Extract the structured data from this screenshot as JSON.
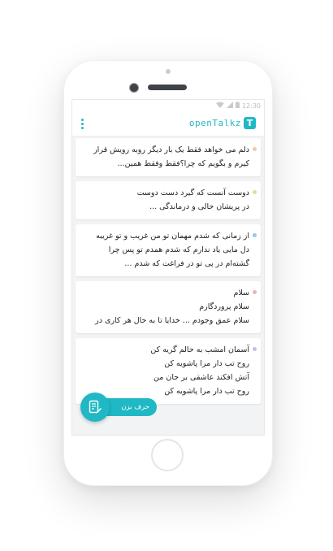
{
  "status_bar": {
    "time": "12:30",
    "icons": [
      "wifi-icon",
      "signal-icon",
      "battery-icon"
    ]
  },
  "app_bar": {
    "brand": "openTalkz",
    "logo_letter": "T",
    "menu_icon": "more-vert-icon"
  },
  "colors": {
    "accent": "#1fb8c4",
    "background": "#f1f3f4"
  },
  "posts": [
    {
      "dot_color": "#f4c7a3",
      "lines": [
        "دلم می خواهد فقط یک بار دیگر روبه رویش قرار",
        "کیرم و بگویم که چرا؟فقط وفقط همین..."
      ]
    },
    {
      "dot_color": "#c9e89a",
      "lines": [
        "دوست آنست که گیرد دست دوست",
        "در پریشان حالی و درماندگی ..."
      ]
    },
    {
      "dot_color": "#8fc9f0",
      "lines": [
        "از زمانی که شدم مهمان تو   من غریب و تو غریبه",
        "دل مایی یاد ندارم که شدم همدم تو پس چرا",
        "گشته‌ام در پی تو در فراغت که شدم ..."
      ]
    },
    {
      "dot_color": "#f4b0b0",
      "lines": [
        "سلام",
        "سلام پروردگارم",
        "سلام عمق وجودم ... خدایا تا به حال هر کاری در"
      ]
    },
    {
      "dot_color": "#cdb9ec",
      "lines": [
        "آسمان امشب به حالم گریه کن",
        "روح تب دار مرا پاشویه کن",
        "آتش افکند عاشقی بر جان من",
        "روح تب دار مرا پاشویه کن"
      ]
    }
  ],
  "fab": {
    "label": "حرف بزن",
    "icon": "compose-note-icon"
  }
}
